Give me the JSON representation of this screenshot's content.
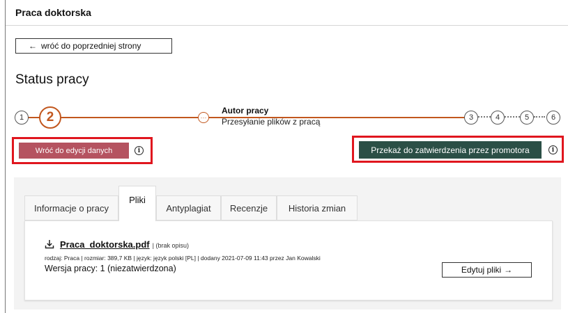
{
  "header": {
    "title": "Praca doktorska"
  },
  "back_button": {
    "arrow": "←",
    "label": "wróć do poprzedniej strony"
  },
  "status_title": "Status pracy",
  "stepper": {
    "steps": [
      "1",
      "2",
      "3",
      "4",
      "5",
      "6"
    ],
    "current_step": "2",
    "current_label_title": "Autor pracy",
    "current_label_subtitle": "Przesyłanie plików z pracą",
    "accent_color": "#c2571e"
  },
  "actions": {
    "back_to_edit_label": "Wróć do edycji danych",
    "forward_label": "Przekaż do zatwierdzenia przez promotora",
    "info_glyph": "i",
    "back_to_edit_color": "#b55360",
    "forward_color": "#2b4f46"
  },
  "tabs": [
    {
      "label": "Informacje o pracy",
      "active": false
    },
    {
      "label": "Pliki",
      "active": true
    },
    {
      "label": "Antyplagiat",
      "active": false
    },
    {
      "label": "Recenzje",
      "active": false
    },
    {
      "label": "Historia zmian",
      "active": false
    }
  ],
  "file": {
    "name": "Praca_doktorska.pdf",
    "description": "| (brak opisu)",
    "meta": "rodzaj: Praca | rozmiar: 389,7 KB | język: język polski [PL] | dodany 2021-07-09 11:43 przez Jan Kowalski",
    "version": "Wersja pracy: 1 (niezatwierdzona)"
  },
  "edit_files_button": {
    "label": "Edytuj pliki",
    "arrow": "→"
  }
}
